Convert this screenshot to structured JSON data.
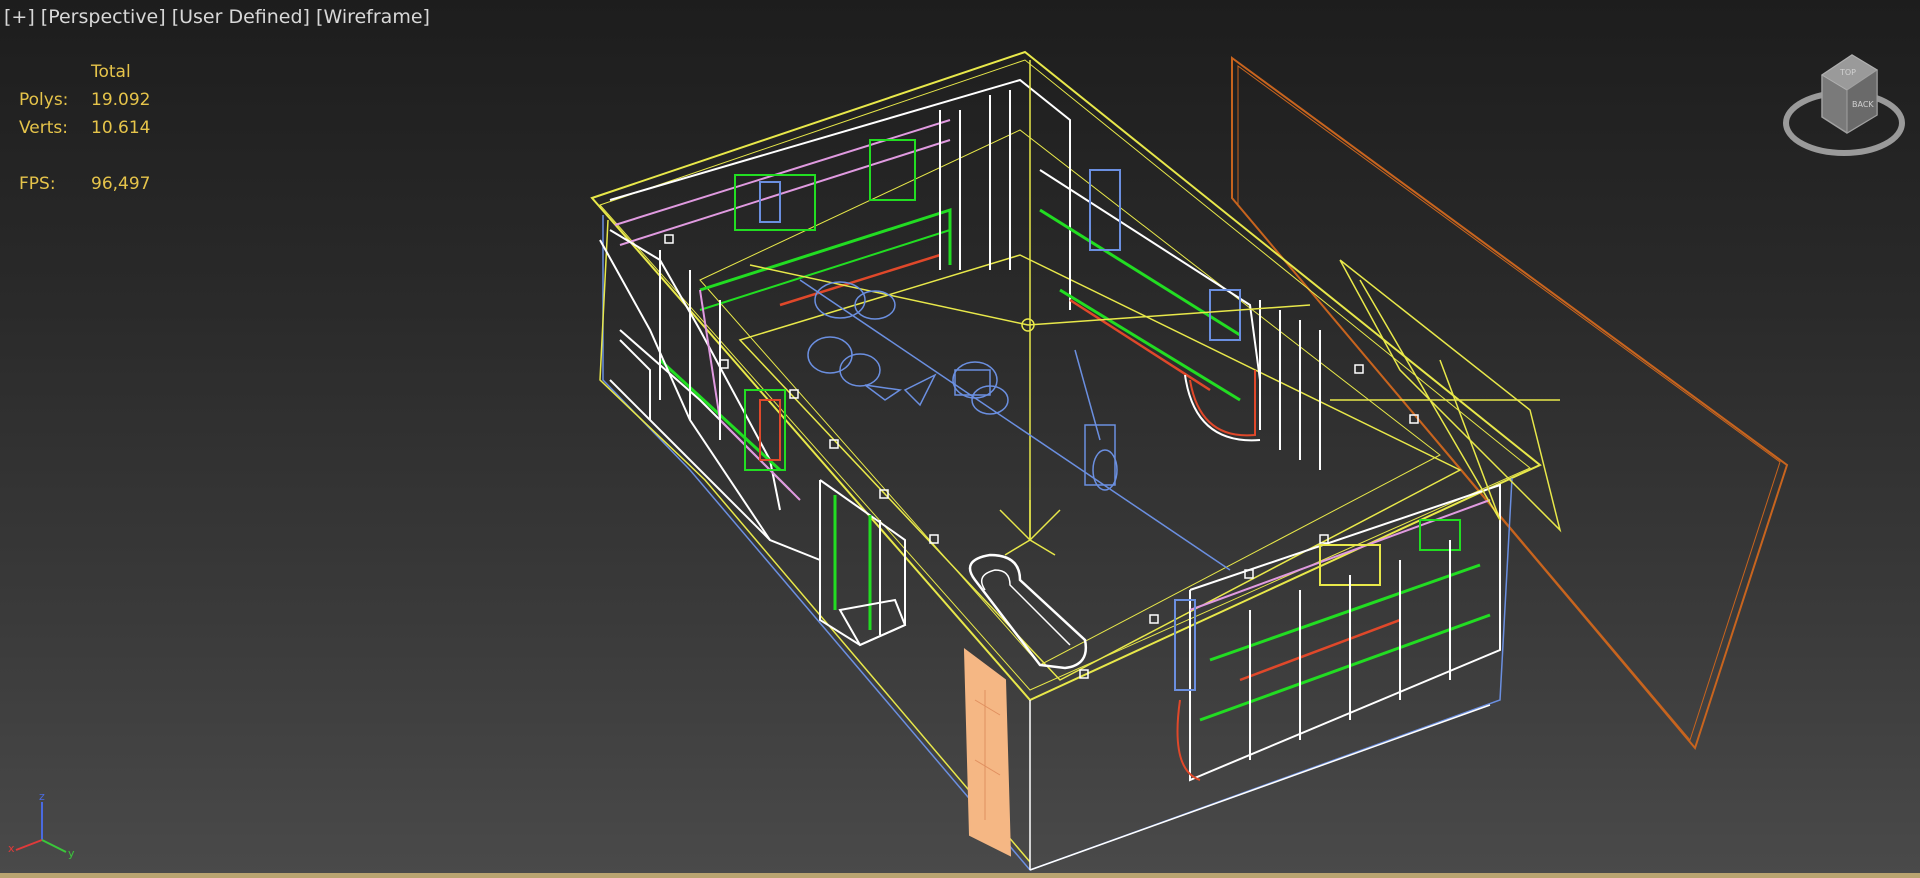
{
  "viewport_label": {
    "plus": "[+]",
    "view": "[Perspective]",
    "shading": "[User Defined]",
    "mode": "[Wireframe]"
  },
  "stats": {
    "column_header": "Total",
    "polys_label": "Polys:",
    "polys_value": "19.092",
    "verts_label": "Verts:",
    "verts_value": "10.614",
    "fps_label": "FPS:",
    "fps_value": "96,497"
  },
  "viewcube": {
    "top_label": "TOP",
    "face_label": "BACK"
  },
  "axis_tripod": {
    "x": "x",
    "y": "y",
    "z": "z"
  },
  "colors": {
    "stats_text": "#e6c44a",
    "label_text": "#d8d8d8",
    "wire_white": "#ffffff",
    "wire_yellow": "#e8e84a",
    "wire_green": "#22dd22",
    "wire_pink": "#e09ae0",
    "wire_blue": "#6b8fe0",
    "wire_red": "#e0482a",
    "wire_orange": "#c8641e",
    "door_fill": "#f5b784",
    "bottom_border": "#b9a470"
  }
}
